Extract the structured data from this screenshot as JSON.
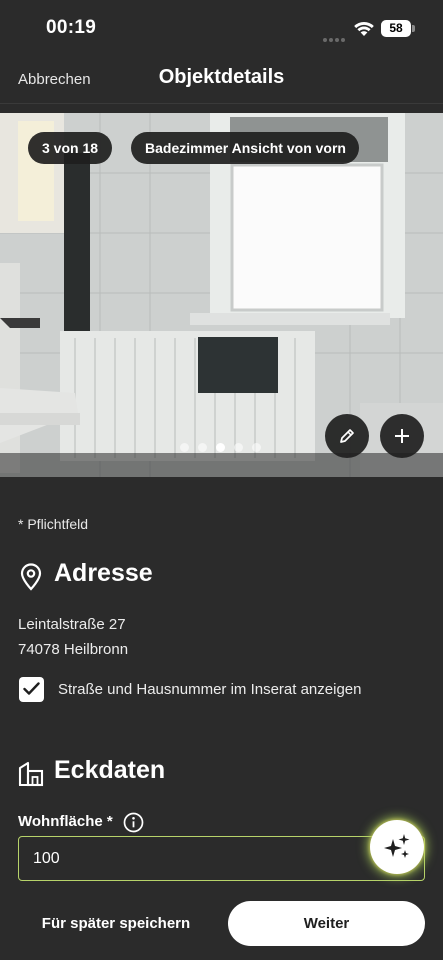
{
  "status_bar": {
    "time": "00:19",
    "battery": "58",
    "icons": [
      "signal-dots-icon",
      "wifi-icon",
      "battery-icon"
    ]
  },
  "nav": {
    "cancel_label": "Abbrechen",
    "title": "Objektdetails"
  },
  "gallery": {
    "counter": "3 von 18",
    "caption": "Badezimmer Ansicht von vorn",
    "dots": {
      "count": 5,
      "active_index": 2
    },
    "icons": [
      "pencil-icon",
      "plus-icon"
    ]
  },
  "form": {
    "required_note": "* Pflichtfeld",
    "address_section": {
      "icon": "location-pin-icon",
      "title": "Adresse",
      "street": "Leintalstraße 27",
      "city": "74078 Heilbronn",
      "show_in_listing_label": "Straße und Hausnummer im Inserat anzeigen",
      "show_in_listing_checked": true
    },
    "key_data_section": {
      "icon": "building-icon",
      "title": "Eckdaten",
      "living_area_label": "Wohnfläche *",
      "living_area_value": "100"
    }
  },
  "footer": {
    "save_later_label": "Für später speichern",
    "next_label": "Weiter"
  },
  "colors": {
    "background": "#2b2b2b",
    "input_border": "#b7d36a",
    "primary_button": "#ffffff"
  }
}
